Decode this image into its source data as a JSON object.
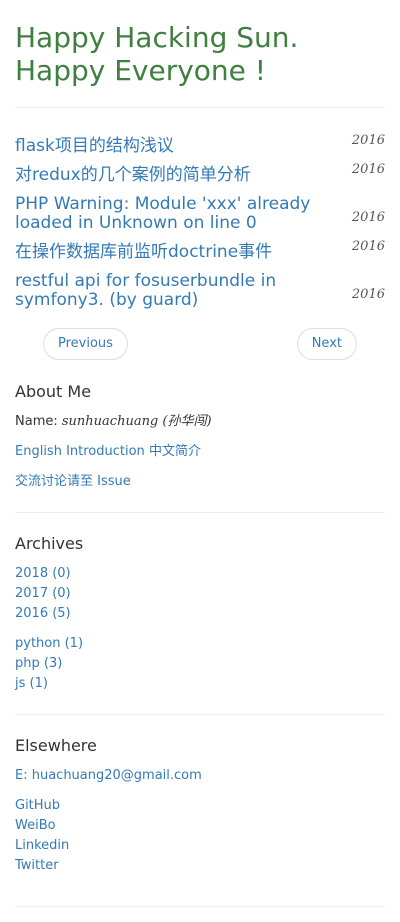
{
  "site": {
    "title": "Happy Hacking Sun. Happy Everyone !"
  },
  "posts": [
    {
      "title": "flask项目的结构浅议",
      "year": "2016"
    },
    {
      "title": "对redux的几个案例的简单分析",
      "year": "2016"
    },
    {
      "title": "PHP Warning: Module 'xxx' already loaded in Unknown on line 0",
      "year": "2016"
    },
    {
      "title": "在操作数据库前监听doctrine事件",
      "year": "2016"
    },
    {
      "title": "restful api for fosuserbundle in symfony3. (by guard)",
      "year": "2016"
    }
  ],
  "pager": {
    "previous": "Previous",
    "next": "Next"
  },
  "about": {
    "title": "About Me",
    "name_label": "Name:",
    "name_value": "sunhuachuang (孙华闯)",
    "english_intro": "English Introduction",
    "chinese_intro": "中文简介",
    "discuss": "交流讨论请至 Issue"
  },
  "archives": {
    "title": "Archives",
    "years": [
      "2018 (0)",
      "2017 (0)",
      "2016 (5)"
    ],
    "tags": [
      "python (1)",
      "php (3)",
      "js (1)"
    ]
  },
  "elsewhere": {
    "title": "Elsewhere",
    "email": "E: huachuang20@gmail.com",
    "links": [
      "GitHub",
      "WeiBo",
      "Linkedin",
      "Twitter"
    ]
  }
}
